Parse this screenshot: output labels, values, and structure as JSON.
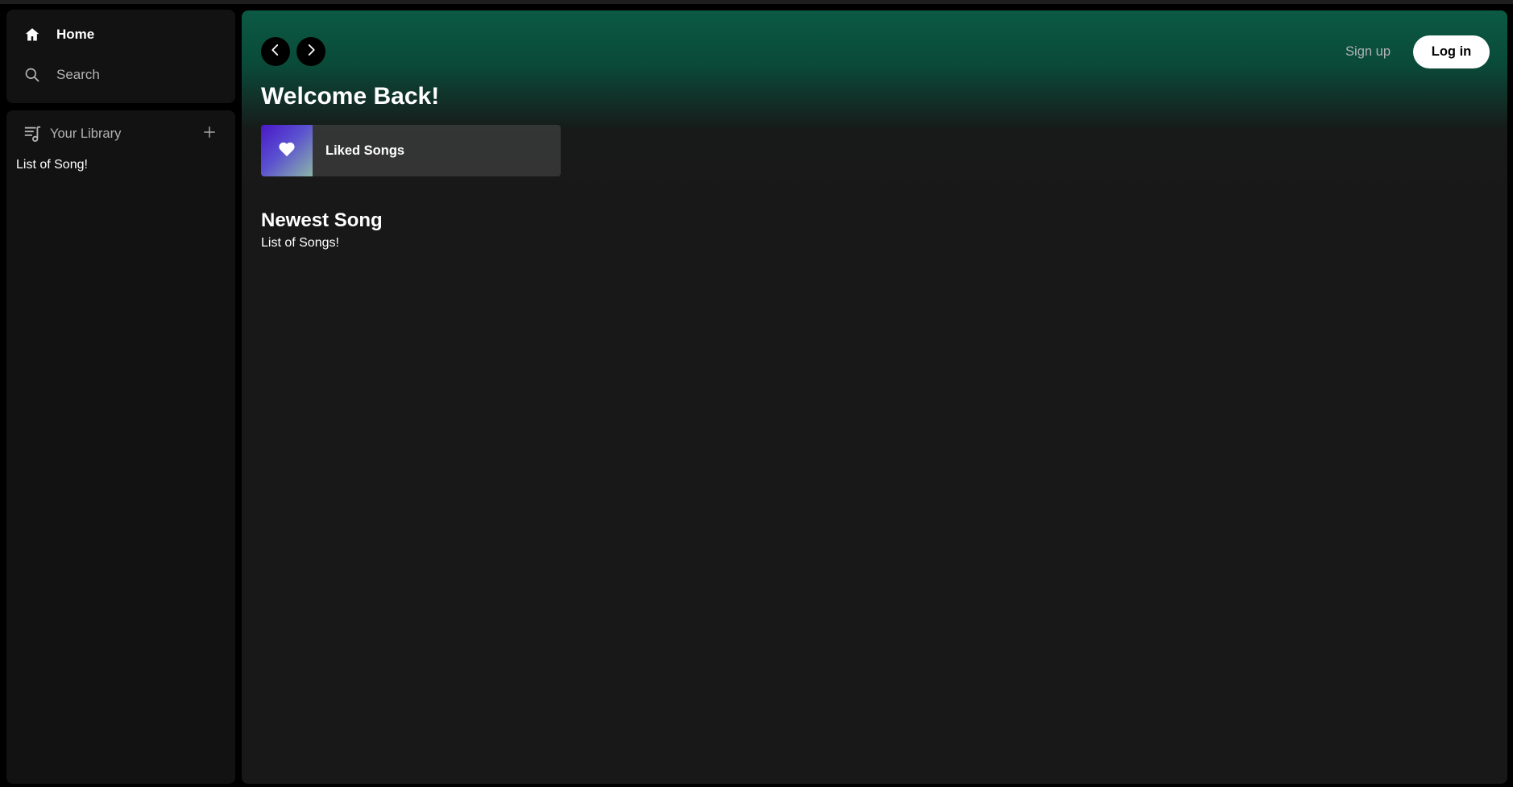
{
  "sidebar": {
    "nav": {
      "home_label": "Home",
      "search_label": "Search"
    },
    "library": {
      "title": "Your Library",
      "items": [
        {
          "label": "List of Song!"
        }
      ]
    }
  },
  "header": {
    "signup_label": "Sign up",
    "login_label": "Log in"
  },
  "main": {
    "welcome": "Welcome Back!",
    "liked_songs_label": "Liked Songs",
    "section_title": "Newest Song",
    "section_subtitle": "List of Songs!"
  },
  "colors": {
    "accent_gradient_top": "#0b5a44",
    "background": "#181818",
    "panel": "#121212",
    "liked_cover_start": "#4a18c8",
    "liked_cover_end": "#8bb5a7"
  },
  "icons": {
    "home": "home-icon",
    "search": "search-icon",
    "library": "library-icon",
    "plus": "plus-icon",
    "back": "chevron-left-icon",
    "forward": "chevron-right-icon",
    "heart": "heart-icon"
  }
}
